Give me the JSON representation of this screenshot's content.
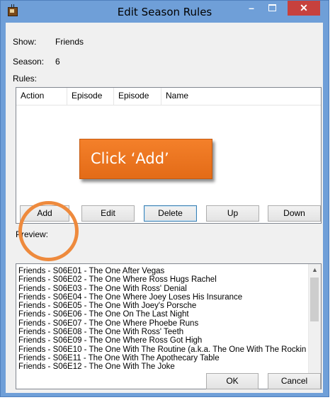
{
  "window": {
    "title": "Edit Season Rules",
    "app_icon": "tv-icon"
  },
  "titlebar": {
    "minimize": "–",
    "close": "✕"
  },
  "show": {
    "label": "Show:",
    "value": "Friends"
  },
  "season": {
    "label": "Season:",
    "value": "6"
  },
  "rules": {
    "label": "Rules:",
    "columns": [
      "Action",
      "Episode",
      "Episode",
      "Name"
    ]
  },
  "callout": {
    "text": "Click ‘Add’",
    "accent": "#ee7a26"
  },
  "buttons": {
    "add": "Add",
    "edit": "Edit",
    "delete": "Delete",
    "up": "Up",
    "down": "Down",
    "ok": "OK",
    "cancel": "Cancel"
  },
  "preview": {
    "label": "Preview:",
    "items": [
      "Friends - S06E01 - The One After Vegas",
      "Friends - S06E02 - The One Where Ross Hugs Rachel",
      "Friends - S06E03 - The One With Ross' Denial",
      "Friends - S06E04 - The One Where Joey Loses His Insurance",
      "Friends - S06E05 - The One With Joey's Porsche",
      "Friends - S06E06 - The One On The Last Night",
      "Friends - S06E07 - The One Where Phoebe Runs",
      "Friends - S06E08 - The One With Ross' Teeth",
      "Friends - S06E09 - The One Where Ross Got High",
      "Friends - S06E10 - The One With The Routine (a.k.a. The One With The Rockin",
      "Friends - S06E11 - The One With The Apothecary Table",
      "Friends - S06E12 - The One With The Joke"
    ]
  },
  "colors": {
    "title_bar": "#6f9fd8",
    "close": "#c7413d",
    "highlight": "#ee8a3d"
  }
}
